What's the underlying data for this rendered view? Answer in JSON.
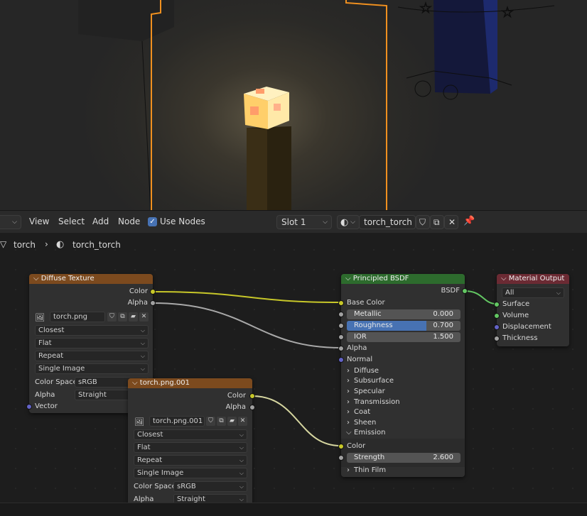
{
  "header": {
    "view": "View",
    "select": "Select",
    "add": "Add",
    "node": "Node",
    "use_nodes": "Use Nodes",
    "slot": "Slot 1",
    "material_name": "torch_torch"
  },
  "breadcrumb": {
    "object": "torch",
    "material": "torch_torch"
  },
  "nodes": {
    "diffuse": {
      "title": "Diffuse Texture",
      "out_color": "Color",
      "out_alpha": "Alpha",
      "image": "torch.png",
      "interpolation": "Closest",
      "projection": "Flat",
      "extension": "Repeat",
      "source": "Single Image",
      "color_space_label": "Color Space",
      "color_space": "sRGB",
      "alpha_label": "Alpha",
      "alpha_mode": "Straight",
      "in_vector": "Vector"
    },
    "emissive": {
      "title": "torch.png.001",
      "out_color": "Color",
      "out_alpha": "Alpha",
      "image": "torch.png.001",
      "interpolation": "Closest",
      "projection": "Flat",
      "extension": "Repeat",
      "source": "Single Image",
      "color_space_label": "Color Space",
      "color_space": "sRGB",
      "alpha_label": "Alpha",
      "alpha_mode": "Straight"
    },
    "bsdf": {
      "title": "Principled BSDF",
      "out": "BSDF",
      "base_color": "Base Color",
      "metallic_label": "Metallic",
      "metallic": "0.000",
      "roughness_label": "Roughness",
      "roughness": "0.700",
      "roughness_fraction": 0.7,
      "ior_label": "IOR",
      "ior": "1.500",
      "alpha": "Alpha",
      "normal": "Normal",
      "panels": [
        "Diffuse",
        "Subsurface",
        "Specular",
        "Transmission",
        "Coat",
        "Sheen"
      ],
      "emission": "Emission",
      "emission_color": "Color",
      "strength_label": "Strength",
      "strength": "2.600",
      "thin_film": "Thin Film"
    },
    "output": {
      "title": "Material Output",
      "target": "All",
      "surface": "Surface",
      "volume": "Volume",
      "displacement": "Displacement",
      "thickness": "Thickness"
    }
  },
  "colors": {
    "texture_header": "#7c4a1e",
    "shader_header": "#2d6b2d",
    "output_header": "#6b2a33",
    "socket_color": "#c7c729",
    "socket_float": "#a1a1a1",
    "socket_vector": "#6363c7",
    "socket_shader": "#63c763",
    "roughness_fill": "#4772b3",
    "selection_outline": "#f0901f"
  }
}
